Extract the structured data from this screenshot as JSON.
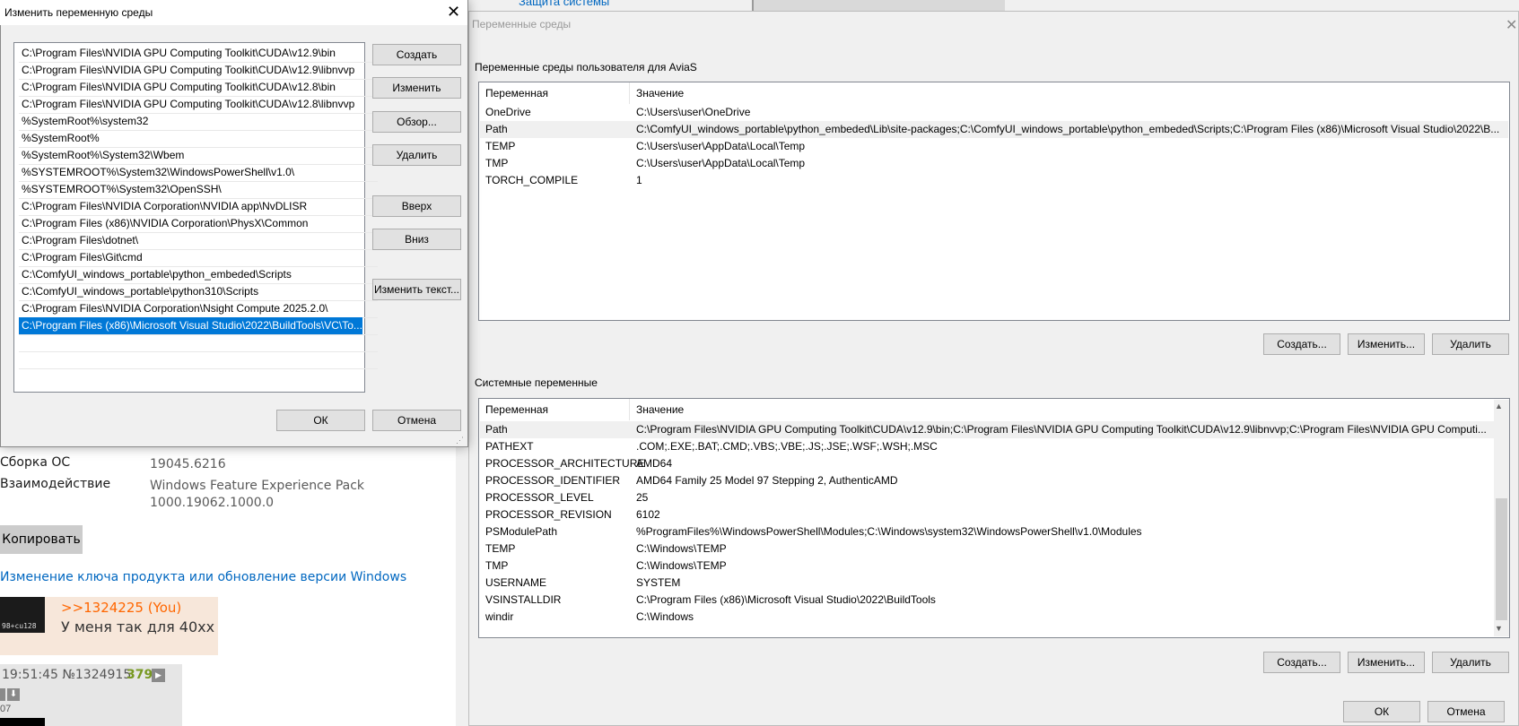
{
  "background": {
    "top_link": "Защита системы",
    "sysinfo": [
      {
        "label": "Сборка ОС",
        "value": "19045.6216"
      },
      {
        "label": "Взаимодействие",
        "value": "Windows Feature Experience Pack",
        "value2": "1000.19062.1000.0"
      }
    ],
    "copy_button": "Копировать",
    "product_key_link": "Изменение ключа продукта или обновление версии Windows",
    "post": {
      "thumb_text": "98+cu128",
      "reply": ">>1324225 (You)",
      "text": "У меня так для 40хх"
    },
    "post2": {
      "time": "19:51:45 №1324915",
      "num": "379",
      "small": "07"
    }
  },
  "env_window": {
    "title": "Переменные среды",
    "user_group_label": "Переменные среды пользователя для AviaS",
    "system_group_label": "Системные переменные",
    "col_name": "Переменная",
    "col_value": "Значение",
    "user_vars": [
      {
        "name": "OneDrive",
        "value": "C:\\Users\\user\\OneDrive"
      },
      {
        "name": "Path",
        "value": "C:\\ComfyUI_windows_portable\\python_embeded\\Lib\\site-packages;C:\\ComfyUI_windows_portable\\python_embeded\\Scripts;C:\\Program Files (x86)\\Microsoft Visual Studio\\2022\\B..."
      },
      {
        "name": "TEMP",
        "value": "C:\\Users\\user\\AppData\\Local\\Temp"
      },
      {
        "name": "TMP",
        "value": "C:\\Users\\user\\AppData\\Local\\Temp"
      },
      {
        "name": "TORCH_COMPILE",
        "value": "1"
      }
    ],
    "system_vars": [
      {
        "name": "Path",
        "value": "C:\\Program Files\\NVIDIA GPU Computing Toolkit\\CUDA\\v12.9\\bin;C:\\Program Files\\NVIDIA GPU Computing Toolkit\\CUDA\\v12.9\\libnvvp;C:\\Program Files\\NVIDIA GPU Computi..."
      },
      {
        "name": "PATHEXT",
        "value": ".COM;.EXE;.BAT;.CMD;.VBS;.VBE;.JS;.JSE;.WSF;.WSH;.MSC"
      },
      {
        "name": "PROCESSOR_ARCHITECTURE",
        "value": "AMD64"
      },
      {
        "name": "PROCESSOR_IDENTIFIER",
        "value": "AMD64 Family 25 Model 97 Stepping 2, AuthenticAMD"
      },
      {
        "name": "PROCESSOR_LEVEL",
        "value": "25"
      },
      {
        "name": "PROCESSOR_REVISION",
        "value": "6102"
      },
      {
        "name": "PSModulePath",
        "value": "%ProgramFiles%\\WindowsPowerShell\\Modules;C:\\Windows\\system32\\WindowsPowerShell\\v1.0\\Modules"
      },
      {
        "name": "TEMP",
        "value": "C:\\Windows\\TEMP"
      },
      {
        "name": "TMP",
        "value": "C:\\Windows\\TEMP"
      },
      {
        "name": "USERNAME",
        "value": "SYSTEM"
      },
      {
        "name": "VSINSTALLDIR",
        "value": "C:\\Program Files (x86)\\Microsoft Visual Studio\\2022\\BuildTools"
      },
      {
        "name": "windir",
        "value": "C:\\Windows"
      }
    ],
    "btn_create": "Создать...",
    "btn_edit": "Изменить...",
    "btn_delete": "Удалить",
    "btn_ok": "ОК",
    "btn_cancel": "Отмена"
  },
  "edit_dialog": {
    "title": "Изменить переменную среды",
    "paths": [
      "C:\\Program Files\\NVIDIA GPU Computing Toolkit\\CUDA\\v12.9\\bin",
      "C:\\Program Files\\NVIDIA GPU Computing Toolkit\\CUDA\\v12.9\\libnvvp",
      "C:\\Program Files\\NVIDIA GPU Computing Toolkit\\CUDA\\v12.8\\bin",
      "C:\\Program Files\\NVIDIA GPU Computing Toolkit\\CUDA\\v12.8\\libnvvp",
      "%SystemRoot%\\system32",
      "%SystemRoot%",
      "%SystemRoot%\\System32\\Wbem",
      "%SYSTEMROOT%\\System32\\WindowsPowerShell\\v1.0\\",
      "%SYSTEMROOT%\\System32\\OpenSSH\\",
      "C:\\Program Files\\NVIDIA Corporation\\NVIDIA app\\NvDLISR",
      "C:\\Program Files (x86)\\NVIDIA Corporation\\PhysX\\Common",
      "C:\\Program Files\\dotnet\\",
      "C:\\Program Files\\Git\\cmd",
      "C:\\ComfyUI_windows_portable\\python_embeded\\Scripts",
      "C:\\ComfyUI_windows_portable\\python310\\Scripts",
      "C:\\Program Files\\NVIDIA Corporation\\Nsight Compute 2025.2.0\\",
      "C:\\Program Files (x86)\\Microsoft Visual Studio\\2022\\BuildTools\\VC\\To..."
    ],
    "selected_index": 16,
    "btn_create": "Создать",
    "btn_edit": "Изменить",
    "btn_browse": "Обзор...",
    "btn_delete": "Удалить",
    "btn_up": "Вверх",
    "btn_down": "Вниз",
    "btn_edit_text": "Изменить текст...",
    "btn_ok": "ОК",
    "btn_cancel": "Отмена"
  },
  "colors": {
    "selection": "#0078d7",
    "link": "#0067c0",
    "reply": "#ff6600"
  }
}
